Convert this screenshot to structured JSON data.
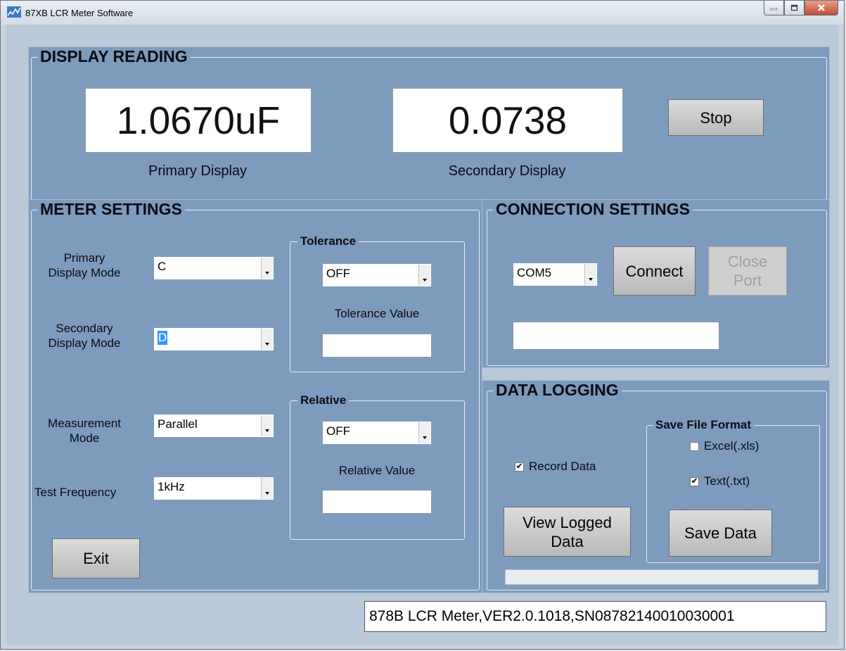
{
  "window": {
    "title": "87XB LCR Meter Software"
  },
  "display_reading": {
    "title": "DISPLAY READING",
    "primary_value": "1.0670uF",
    "primary_label": "Primary Display",
    "secondary_value": "0.0738",
    "secondary_label": "Secondary Display",
    "stop_label": "Stop"
  },
  "meter_settings": {
    "title": "METER SETTINGS",
    "primary_mode_label": "Primary\nDisplay Mode",
    "primary_mode_value": "C",
    "secondary_mode_label": "Secondary\nDisplay Mode",
    "secondary_mode_value": "D",
    "measurement_mode_label": "Measurement\nMode",
    "measurement_mode_value": "Parallel",
    "test_frequency_label": "Test Frequency",
    "test_frequency_value": "1kHz",
    "tolerance": {
      "title": "Tolerance",
      "value": "OFF",
      "value_label": "Tolerance Value",
      "input_value": ""
    },
    "relative": {
      "title": "Relative",
      "value": "OFF",
      "value_label": "Relative Value",
      "input_value": ""
    },
    "exit_label": "Exit"
  },
  "connection_settings": {
    "title": "CONNECTION SETTINGS",
    "port_value": "COM5",
    "connect_label": "Connect",
    "close_port_label": "Close\nPort",
    "status_value": ""
  },
  "data_logging": {
    "title": "DATA LOGGING",
    "record_data_label": "Record Data",
    "record_data_checked": true,
    "view_logged_label": "View Logged\nData",
    "save_format_title": "Save File Format",
    "excel_label": "Excel(.xls)",
    "excel_checked": false,
    "text_label": "Text(.txt)",
    "text_checked": true,
    "save_data_label": "Save Data",
    "progress": 0
  },
  "status_bar": {
    "text": "878B LCR Meter,VER2.0.1018,SN08782140010030001"
  }
}
